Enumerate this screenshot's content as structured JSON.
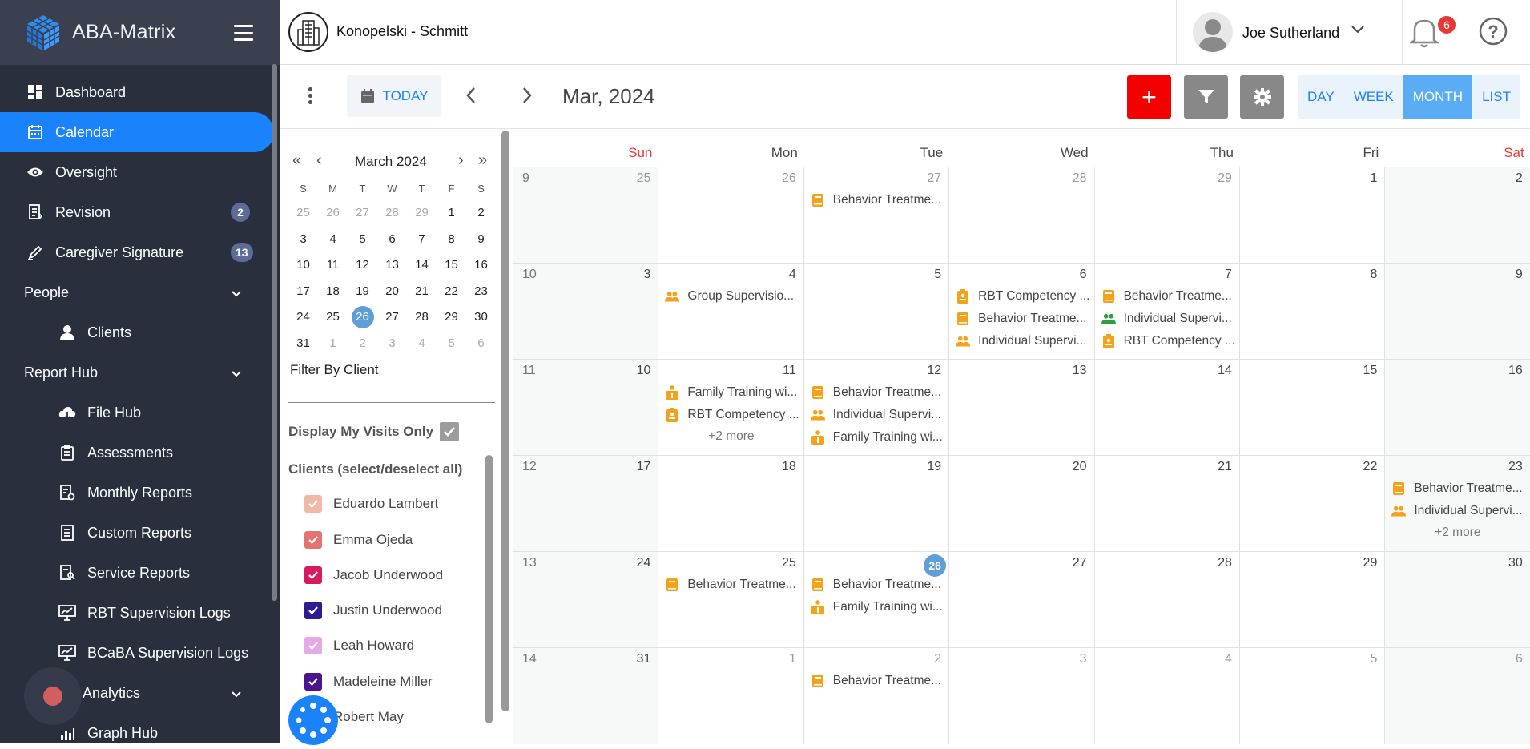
{
  "app": {
    "brand": "ABA-Matrix"
  },
  "sidebar": {
    "items": [
      {
        "label": "Dashboard",
        "icon": "dashboard-icon"
      },
      {
        "label": "Calendar",
        "icon": "calendar-icon",
        "active": true
      },
      {
        "label": "Oversight",
        "icon": "eye-icon"
      },
      {
        "label": "Revision",
        "icon": "document-icon",
        "badge": "2"
      },
      {
        "label": "Caregiver Signature",
        "icon": "pen-icon",
        "badge": "13"
      }
    ],
    "people": {
      "label": "People",
      "items": [
        {
          "label": "Clients",
          "icon": "person-icon"
        }
      ]
    },
    "report_hub": {
      "label": "Report Hub",
      "items": [
        {
          "label": "File Hub",
          "icon": "cloud-icon"
        },
        {
          "label": "Assessments",
          "icon": "clipboard-icon"
        },
        {
          "label": "Monthly Reports",
          "icon": "report-gear-icon"
        },
        {
          "label": "Custom Reports",
          "icon": "report-list-icon"
        },
        {
          "label": "Service Reports",
          "icon": "report-search-icon"
        },
        {
          "label": "RBT Supervision Logs",
          "icon": "presentation-chart-icon"
        },
        {
          "label": "BCaBA Supervision Logs",
          "icon": "presentation-chart-icon"
        }
      ]
    },
    "analytics": {
      "label": "Analytics",
      "items": [
        {
          "label": "Graph Hub",
          "icon": "bar-chart-icon"
        }
      ]
    }
  },
  "topbar": {
    "org_name": "Konopelski - Schmitt",
    "user_name": "Joe Sutherland",
    "notification_count": "6"
  },
  "toolbar": {
    "today_label": "TODAY",
    "month_title": "Mar, 2024",
    "add_label": "+",
    "views": [
      "DAY",
      "WEEK",
      "MONTH",
      "LIST"
    ],
    "active_view": "MONTH"
  },
  "mini_calendar": {
    "title": "March 2024",
    "dow": [
      "S",
      "M",
      "T",
      "W",
      "T",
      "F",
      "S"
    ],
    "weeks": [
      [
        "25",
        "26",
        "27",
        "28",
        "29",
        "1",
        "2"
      ],
      [
        "3",
        "4",
        "5",
        "6",
        "7",
        "8",
        "9"
      ],
      [
        "10",
        "11",
        "12",
        "13",
        "14",
        "15",
        "16"
      ],
      [
        "17",
        "18",
        "19",
        "20",
        "21",
        "22",
        "23"
      ],
      [
        "24",
        "25",
        "26",
        "27",
        "28",
        "29",
        "30"
      ],
      [
        "31",
        "1",
        "2",
        "3",
        "4",
        "5",
        "6"
      ]
    ],
    "selected": "26"
  },
  "filters": {
    "filter_by_client": "Filter By Client",
    "my_visits_label": "Display My Visits Only",
    "clients_title": "Clients (select/deselect all)",
    "clients": [
      {
        "name": "Eduardo Lambert",
        "color": "#efb9a8"
      },
      {
        "name": "Emma Ojeda",
        "color": "#e57373"
      },
      {
        "name": "Jacob Underwood",
        "color": "#d81b60"
      },
      {
        "name": "Justin Underwood",
        "color": "#311b92"
      },
      {
        "name": "Leah Howard",
        "color": "#e6a8e6"
      },
      {
        "name": "Madeleine Miller",
        "color": "#4a148c"
      },
      {
        "name": "Robert May",
        "color": "#1a82fb"
      }
    ]
  },
  "calendar": {
    "dow": [
      "Sun",
      "Mon",
      "Tue",
      "Wed",
      "Thu",
      "Fri",
      "Sat"
    ],
    "weeks": [
      {
        "wk": "9",
        "days": [
          {
            "d": "25",
            "other": true,
            "events": []
          },
          {
            "d": "26",
            "other": true,
            "events": []
          },
          {
            "d": "27",
            "other": true,
            "events": [
              {
                "t": "Behavior Treatme...",
                "i": "book"
              }
            ]
          },
          {
            "d": "28",
            "other": true,
            "events": []
          },
          {
            "d": "29",
            "other": true,
            "events": []
          },
          {
            "d": "1",
            "events": []
          },
          {
            "d": "2",
            "events": []
          }
        ]
      },
      {
        "wk": "10",
        "days": [
          {
            "d": "3",
            "events": []
          },
          {
            "d": "4",
            "events": [
              {
                "t": "Group Supervisio...",
                "i": "group"
              }
            ]
          },
          {
            "d": "5",
            "events": []
          },
          {
            "d": "6",
            "events": [
              {
                "t": "RBT Competency ...",
                "i": "badge"
              },
              {
                "t": "Behavior Treatme...",
                "i": "book"
              },
              {
                "t": "Individual Supervi...",
                "i": "group"
              }
            ]
          },
          {
            "d": "7",
            "events": [
              {
                "t": "Behavior Treatme...",
                "i": "book"
              },
              {
                "t": "Individual Supervi...",
                "i": "group-green"
              },
              {
                "t": "RBT Competency ...",
                "i": "badge"
              }
            ]
          },
          {
            "d": "8",
            "events": []
          },
          {
            "d": "9",
            "events": []
          }
        ]
      },
      {
        "wk": "11",
        "days": [
          {
            "d": "10",
            "events": []
          },
          {
            "d": "11",
            "events": [
              {
                "t": "Family Training wi...",
                "i": "family"
              },
              {
                "t": "RBT Competency ...",
                "i": "badge"
              }
            ],
            "more": "+2 more"
          },
          {
            "d": "12",
            "events": [
              {
                "t": "Behavior Treatme...",
                "i": "book"
              },
              {
                "t": "Individual Supervi...",
                "i": "group"
              },
              {
                "t": "Family Training wi...",
                "i": "family"
              }
            ]
          },
          {
            "d": "13",
            "events": []
          },
          {
            "d": "14",
            "events": []
          },
          {
            "d": "15",
            "events": []
          },
          {
            "d": "16",
            "events": []
          }
        ]
      },
      {
        "wk": "12",
        "days": [
          {
            "d": "17",
            "events": []
          },
          {
            "d": "18",
            "events": []
          },
          {
            "d": "19",
            "events": []
          },
          {
            "d": "20",
            "events": []
          },
          {
            "d": "21",
            "events": []
          },
          {
            "d": "22",
            "events": []
          },
          {
            "d": "23",
            "events": [
              {
                "t": "Behavior Treatme...",
                "i": "book"
              },
              {
                "t": "Individual Supervi...",
                "i": "group"
              }
            ],
            "more": "+2 more"
          }
        ]
      },
      {
        "wk": "13",
        "days": [
          {
            "d": "24",
            "events": []
          },
          {
            "d": "25",
            "events": [
              {
                "t": "Behavior Treatme...",
                "i": "book"
              }
            ]
          },
          {
            "d": "26",
            "today": true,
            "events": [
              {
                "t": "Behavior Treatme...",
                "i": "book"
              },
              {
                "t": "Family Training wi...",
                "i": "family"
              }
            ]
          },
          {
            "d": "27",
            "events": []
          },
          {
            "d": "28",
            "events": []
          },
          {
            "d": "29",
            "events": []
          },
          {
            "d": "30",
            "events": []
          }
        ]
      },
      {
        "wk": "14",
        "days": [
          {
            "d": "31",
            "events": []
          },
          {
            "d": "1",
            "other": true,
            "events": []
          },
          {
            "d": "2",
            "other": true,
            "events": [
              {
                "t": "Behavior Treatme...",
                "i": "book"
              }
            ]
          },
          {
            "d": "3",
            "other": true,
            "events": []
          },
          {
            "d": "4",
            "other": true,
            "events": []
          },
          {
            "d": "5",
            "other": true,
            "events": []
          },
          {
            "d": "6",
            "other": true,
            "events": []
          }
        ]
      }
    ]
  },
  "colors": {
    "accent": "#1a82fb",
    "event_orange": "#f4a11c",
    "event_green": "#2e9d3e",
    "add_red": "#f40000"
  }
}
